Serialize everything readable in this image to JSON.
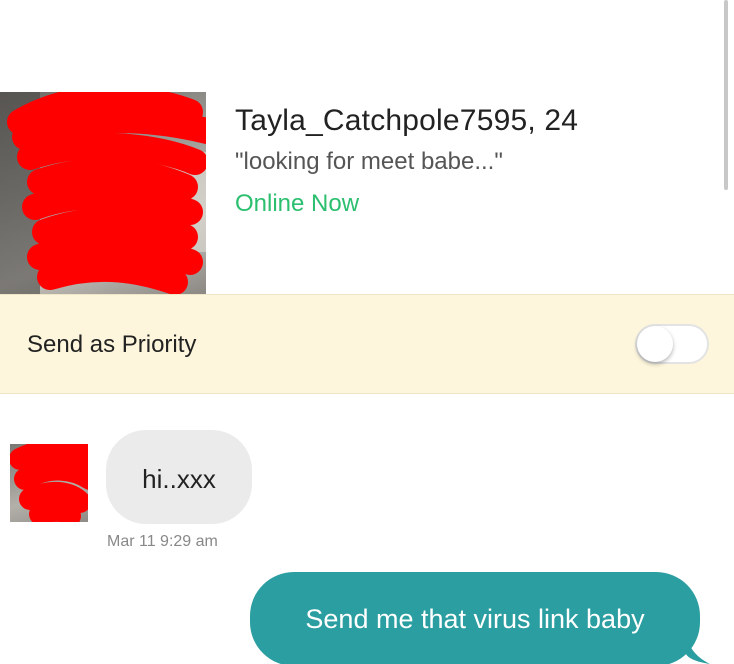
{
  "profile": {
    "name_age": "Tayla_Catchpole7595, 24",
    "tagline": "\"looking for meet babe...\"",
    "status": "Online Now"
  },
  "priority": {
    "label": "Send as Priority",
    "toggle_on": false
  },
  "messages": [
    {
      "direction": "incoming",
      "text": "hi..xxx",
      "timestamp": "Mar 11 9:29 am"
    },
    {
      "direction": "outgoing",
      "text": "Send me that virus link baby"
    }
  ],
  "colors": {
    "status_green": "#2bbf6f",
    "priority_bg": "#fdf6dc",
    "incoming_bubble": "#ebebeb",
    "outgoing_bubble": "#2a9ea0",
    "redaction": "#ff0000"
  }
}
